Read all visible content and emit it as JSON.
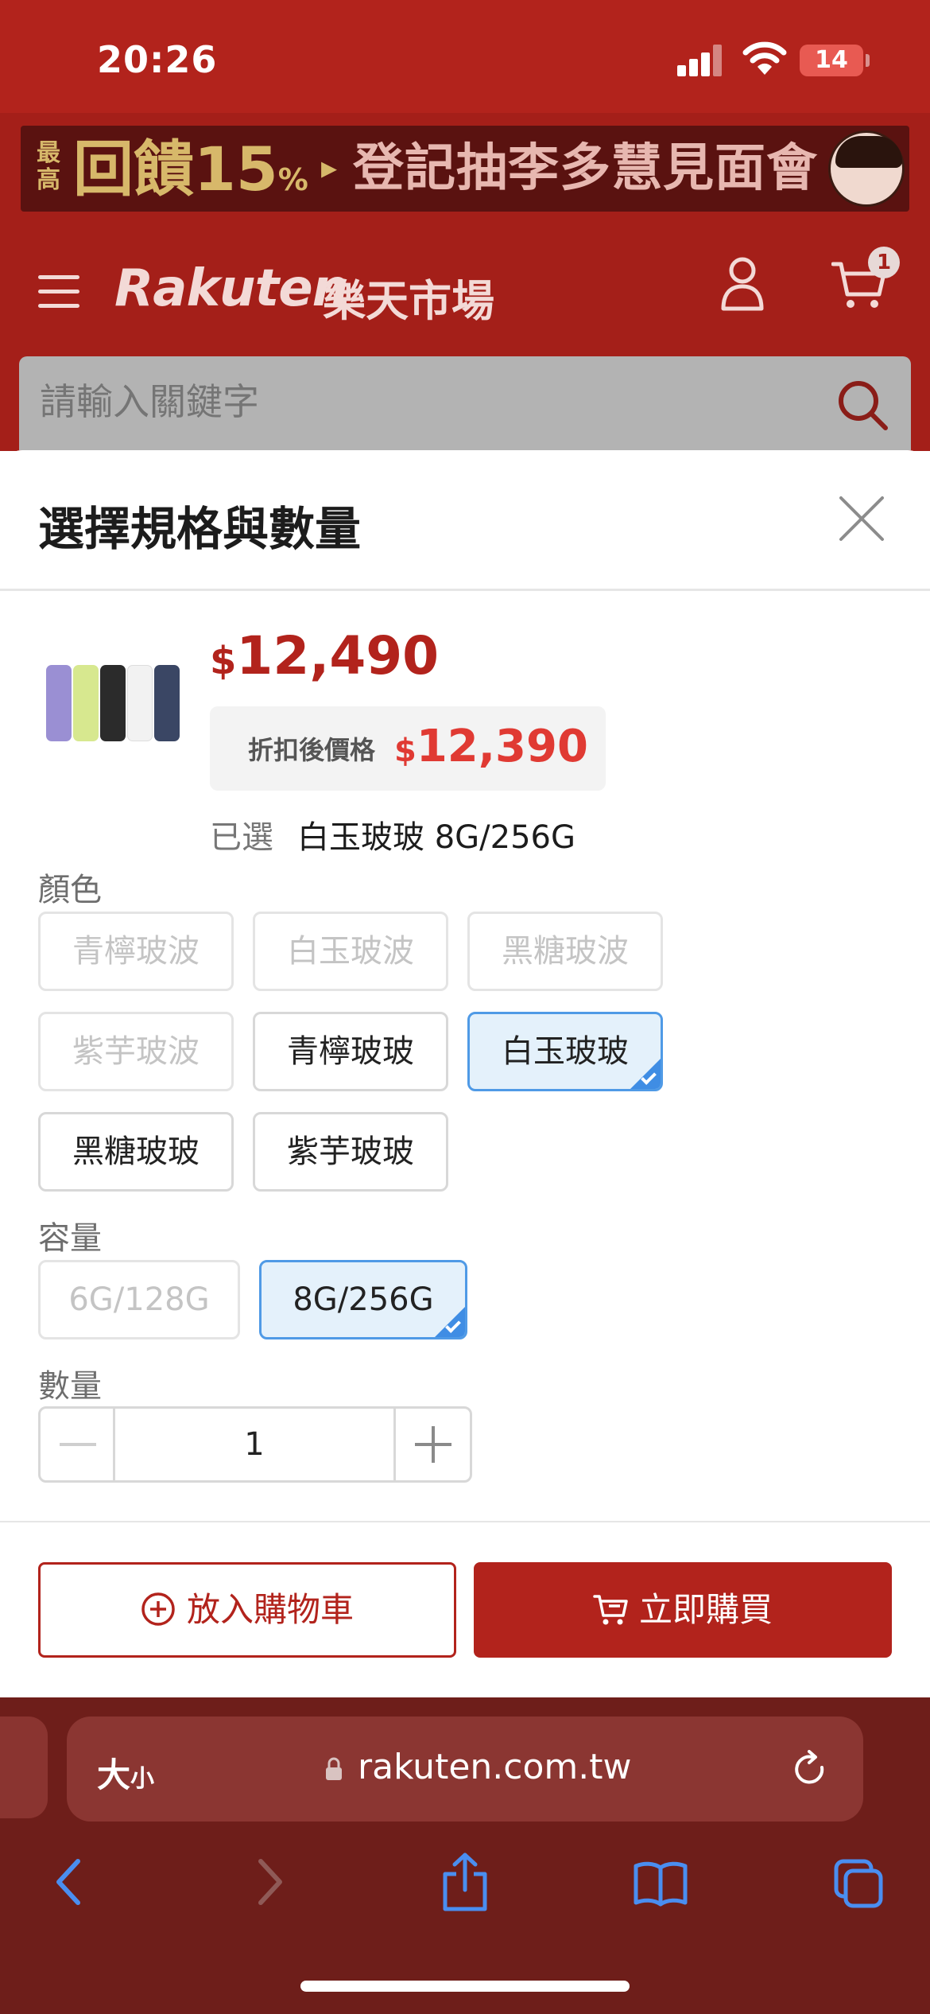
{
  "status_bar": {
    "time": "20:26",
    "battery": "14"
  },
  "promo": {
    "small": "最高",
    "big": "回饋15",
    "pct": "%",
    "arrow": "▸",
    "text": "登記抽李多慧見面會"
  },
  "header": {
    "logo": "Rakuten",
    "logo_cn": "樂天市場",
    "cart_count": "1"
  },
  "search": {
    "placeholder": "請輸入關鍵字"
  },
  "sheet": {
    "title": "選擇規格與數量",
    "currency": "$",
    "price": "12,490",
    "discount_label": "折扣後價格",
    "discount_price": "12,390",
    "selected_label": "已選",
    "selected_value": "白玉玻玻 8G/256G",
    "color_label": "顏色",
    "colors": [
      {
        "label": "青檸玻波"
      },
      {
        "label": "白玉玻波"
      },
      {
        "label": "黑糖玻波"
      },
      {
        "label": "紫芋玻波"
      },
      {
        "label": "青檸玻玻"
      },
      {
        "label": "白玉玻玻"
      },
      {
        "label": "黑糖玻玻"
      },
      {
        "label": "紫芋玻玻"
      }
    ],
    "capacity_label": "容量",
    "capacities": [
      {
        "label": "6G/128G"
      },
      {
        "label": "8G/256G"
      }
    ],
    "quantity_label": "數量",
    "quantity": "1",
    "add_to_cart": "放入購物車",
    "buy_now": "立即購買"
  },
  "browser": {
    "aa": "大",
    "aa_small": "小",
    "url": "rakuten.com.tw"
  },
  "colors": {
    "brand": "#b2231c",
    "selected_border": "#4f9ae6",
    "selected_bg": "#e4f1fb",
    "safari_icon": "#4a8ef0"
  }
}
